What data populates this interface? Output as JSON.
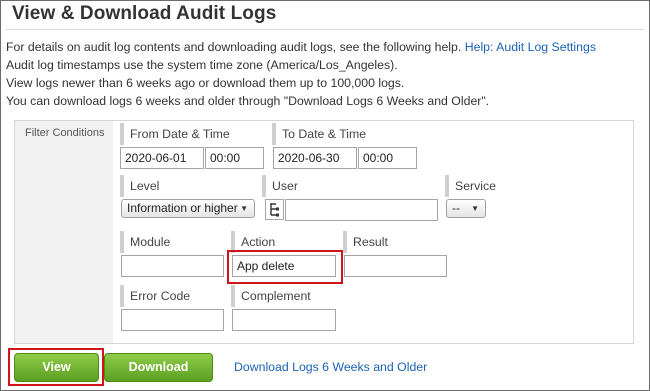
{
  "page": {
    "title": "View & Download Audit Logs",
    "description": {
      "line1_text": "For details on audit log contents and downloading audit logs, see the following help.",
      "help_link": "Help: Audit Log Settings",
      "line2": "Audit log timestamps use the system time zone (America/Los_Angeles).",
      "line3": "View logs newer than 6 weeks ago or download them up to 100,000 logs.",
      "line4": "You can download logs 6 weeks and older through \"Download Logs 6 Weeks and Older\"."
    }
  },
  "filter": {
    "section_label": "Filter Conditions",
    "from": {
      "label": "From Date & Time",
      "date": "2020-06-01",
      "time": "00:00"
    },
    "to": {
      "label": "To Date & Time",
      "date": "2020-06-30",
      "time": "00:00"
    },
    "level": {
      "label": "Level",
      "selected": "Information or higher"
    },
    "user": {
      "label": "User",
      "value": ""
    },
    "service": {
      "label": "Service",
      "selected": "--"
    },
    "module": {
      "label": "Module",
      "value": ""
    },
    "action": {
      "label": "Action",
      "value": "App delete"
    },
    "result": {
      "label": "Result",
      "value": ""
    },
    "error_code": {
      "label": "Error Code",
      "value": ""
    },
    "complement": {
      "label": "Complement",
      "value": ""
    }
  },
  "actions": {
    "view_label": "View",
    "download_label": "Download",
    "download_old_label": "Download Logs 6 Weeks and Older"
  },
  "colors": {
    "link": "#1a63b5",
    "button_green": "#6fb12c",
    "highlight": "#d0141b"
  }
}
